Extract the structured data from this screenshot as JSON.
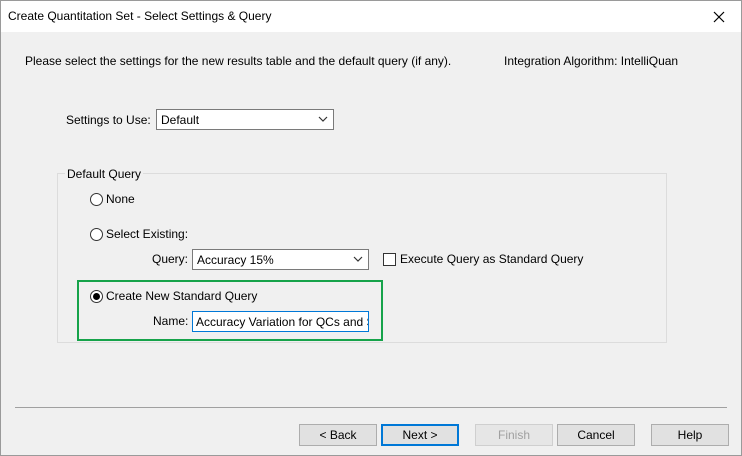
{
  "window": {
    "title": "Create Quantitation Set - Select Settings & Query",
    "close_icon": "close-icon"
  },
  "intro": {
    "text": "Please select the settings for the new results table and the default query (if any).",
    "algorithm": "Integration Algorithm: IntelliQuan"
  },
  "settings": {
    "label": "Settings to Use:",
    "value": "Default"
  },
  "default_query": {
    "group_label": "Default Query",
    "none_label": "None",
    "select_existing_label": "Select Existing:",
    "query_label": "Query:",
    "query_value": "Accuracy 15%",
    "execute_label": "Execute Query as Standard Query",
    "execute_checked": false,
    "create_new_label": "Create New Standard Query",
    "name_label": "Name:",
    "name_value": "Accuracy Variation for QCs and S",
    "selected": "create_new",
    "highlight_color": "#16a34a"
  },
  "buttons": {
    "back": "< Back",
    "next": "Next >",
    "finish": "Finish",
    "cancel": "Cancel",
    "help": "Help"
  }
}
